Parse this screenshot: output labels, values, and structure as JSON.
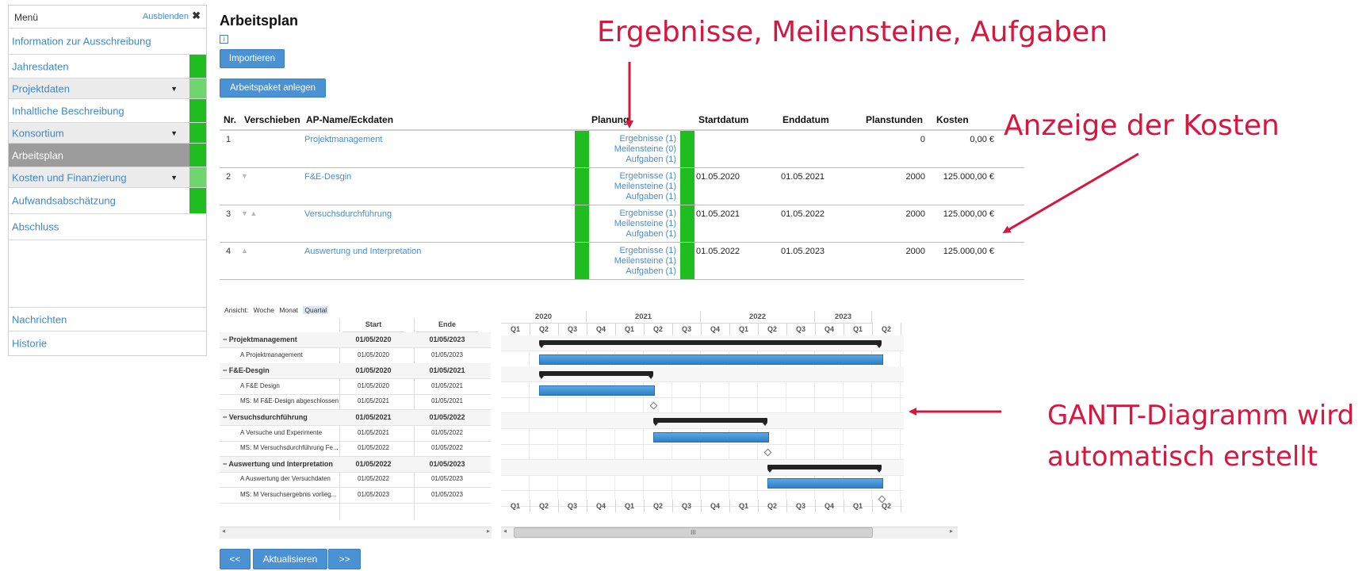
{
  "sidebar": {
    "menu_title": "Menü",
    "hide_label": "Ausblenden",
    "close_glyph": "✖",
    "items": [
      {
        "label": "Information zur Ausschreibung"
      },
      {
        "label": "Jahresdaten"
      },
      {
        "label": "Projektdaten"
      },
      {
        "label": "Inhaltliche Beschreibung"
      },
      {
        "label": "Konsortium"
      },
      {
        "label": "Arbeitsplan"
      },
      {
        "label": "Kosten und Finanzierung"
      },
      {
        "label": "Aufwandsabschätzung"
      },
      {
        "label": "Abschluss"
      },
      {
        "label": "Nachrichten"
      },
      {
        "label": "Historie"
      }
    ],
    "status_color": "#1fbd1f"
  },
  "main": {
    "title": "Arbeitsplan",
    "info_icon": "i",
    "import_button": "Importieren",
    "add_button": "Arbeitspaket anlegen"
  },
  "table": {
    "headers": {
      "nr": "Nr.",
      "move": "Verschieben",
      "name": "AP-Name/Eckdaten",
      "planning": "Planung",
      "start": "Startdatum",
      "end": "Enddatum",
      "hours": "Planstunden",
      "cost": "Kosten"
    },
    "rows": [
      {
        "nr": "1",
        "arrows": "",
        "name": "Projektmanagement",
        "results": "Ergebnisse (1)",
        "milestones": "Meilensteine (0)",
        "tasks": "Aufgaben (1)",
        "start": "",
        "end": "",
        "hours": "0",
        "cost": "0,00 €"
      },
      {
        "nr": "2",
        "arrows": "▼",
        "name": "F&E-Desgin",
        "results": "Ergebnisse (1)",
        "milestones": "Meilensteine (1)",
        "tasks": "Aufgaben (1)",
        "start": "01.05.2020",
        "end": "01.05.2021",
        "hours": "2000",
        "cost": "125.000,00 €"
      },
      {
        "nr": "3",
        "arrows": "▼ ▲",
        "name": "Versuchsdurchführung",
        "results": "Ergebnisse (1)",
        "milestones": "Meilensteine (1)",
        "tasks": "Aufgaben (1)",
        "start": "01.05.2021",
        "end": "01.05.2022",
        "hours": "2000",
        "cost": "125.000,00 €"
      },
      {
        "nr": "4",
        "arrows": "▲",
        "name": "Auswertung und Interpretation",
        "results": "Ergebnisse (1)",
        "milestones": "Meilensteine (1)",
        "tasks": "Aufgaben (1)",
        "start": "01.05.2022",
        "end": "01.05.2023",
        "hours": "2000",
        "cost": "125.000,00 €"
      }
    ]
  },
  "gantt": {
    "view_label": "Ansicht:",
    "view_options": [
      "Woche",
      "Monat",
      "Quartal"
    ],
    "view_selected": "Quartal",
    "col_start": "Start",
    "col_end": "Ende",
    "rows": [
      {
        "name": "− Projektmanagement",
        "start": "01/05/2020",
        "end": "01/05/2023",
        "group": true
      },
      {
        "name": "A  Projektmanagement",
        "start": "01/05/2020",
        "end": "01/05/2023",
        "group": false
      },
      {
        "name": "− F&E-Desgin",
        "start": "01/05/2020",
        "end": "01/05/2021",
        "group": true
      },
      {
        "name": "A  F&E Design",
        "start": "01/05/2020",
        "end": "01/05/2021",
        "group": false
      },
      {
        "name": "MS: M  F&E-Design abgeschlossen",
        "start": "01/05/2021",
        "end": "01/05/2021",
        "group": false
      },
      {
        "name": "− Versuchsdurchführung",
        "start": "01/05/2021",
        "end": "01/05/2022",
        "group": true
      },
      {
        "name": "A  Versuche und Experimente",
        "start": "01/05/2021",
        "end": "01/05/2022",
        "group": false
      },
      {
        "name": "MS: M  Versuchsdurchführung  Fe...",
        "start": "01/05/2022",
        "end": "01/05/2022",
        "group": false
      },
      {
        "name": "− Auswertung und Interpretation",
        "start": "01/05/2022",
        "end": "01/05/2023",
        "group": true
      },
      {
        "name": "A  Auswertung der Versuchdaten",
        "start": "01/05/2022",
        "end": "01/05/2023",
        "group": false
      },
      {
        "name": "MS: M  Versuchsergebnis vorlieg...",
        "start": "01/05/2023",
        "end": "01/05/2023",
        "group": false
      }
    ],
    "years": [
      {
        "label": "2020",
        "quarters": 3
      },
      {
        "label": "2021",
        "quarters": 4
      },
      {
        "label": "2022",
        "quarters": 4
      },
      {
        "label": "2023",
        "quarters": 2
      }
    ],
    "quarters": [
      "Q1",
      "Q2",
      "Q3",
      "Q4",
      "Q1",
      "Q2",
      "Q3",
      "Q4",
      "Q1",
      "Q2",
      "Q3",
      "Q4",
      "Q1",
      "Q2"
    ],
    "scroll_grip": "III"
  },
  "nav": {
    "prev": "<<",
    "update": "Aktualisieren",
    "next": ">>"
  },
  "annotations": {
    "top": "Ergebnisse, Meilensteine, Aufgaben",
    "costs": "Anzeige der Kosten",
    "gantt_line1": "GANTT-Diagramm wird",
    "gantt_line2": "automatisch erstellt",
    "color": "#d6173f"
  }
}
